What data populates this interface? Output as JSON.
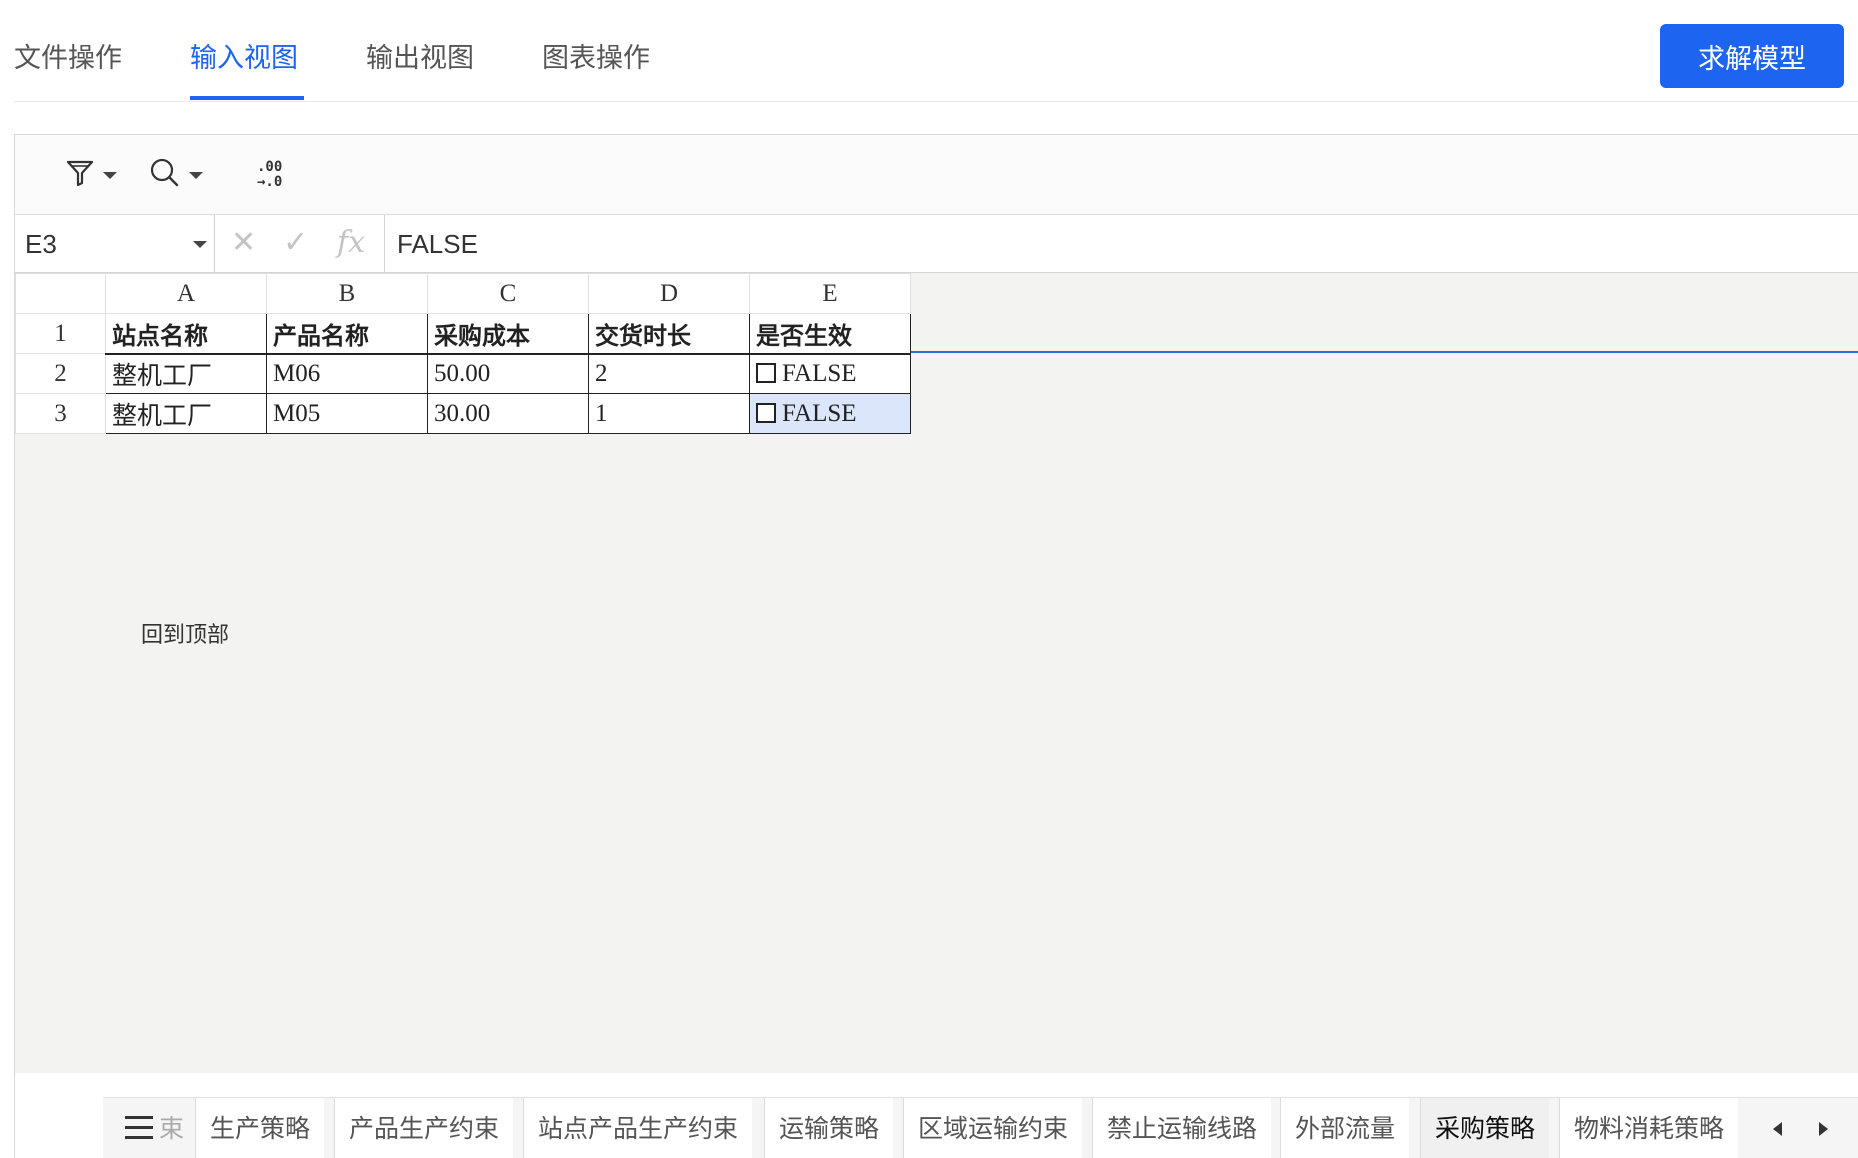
{
  "topnav": {
    "tabs": [
      {
        "label": "文件操作"
      },
      {
        "label": "输入视图"
      },
      {
        "label": "输出视图"
      },
      {
        "label": "图表操作"
      }
    ],
    "active_tab": "输入视图",
    "solve_label": "求解模型",
    "accent_color": "#1d64f0"
  },
  "toolbar": {
    "icons": [
      "filter-icon",
      "search-icon",
      "decimal-format-icon"
    ],
    "decimal_top": ".00",
    "decimal_bottom": "→.0"
  },
  "formula_bar": {
    "cell_ref": "E3",
    "cancel_glyph": "✕",
    "confirm_glyph": "✓",
    "fx_label": "fx",
    "value": "FALSE"
  },
  "grid": {
    "columns": [
      "A",
      "B",
      "C",
      "D",
      "E"
    ],
    "row_numbers": [
      "1",
      "2",
      "3"
    ],
    "headers": [
      "站点名称",
      "产品名称",
      "采购成本",
      "交货时长",
      "是否生效"
    ],
    "rows": [
      [
        "整机工厂",
        "M06",
        "50.00",
        "2",
        "FALSE"
      ],
      [
        "整机工厂",
        "M05",
        "30.00",
        "1",
        "FALSE"
      ]
    ],
    "selected_cell": "E3"
  },
  "back_to_top": "回到顶部",
  "sheet_tabs": {
    "partial_label": "束",
    "tabs": [
      "生产策略",
      "产品生产约束",
      "站点产品生产约束",
      "运输策略",
      "区域运输约束",
      "禁止运输线路",
      "外部流量",
      "采购策略",
      "物料消耗策略"
    ],
    "active": "采购策略"
  }
}
